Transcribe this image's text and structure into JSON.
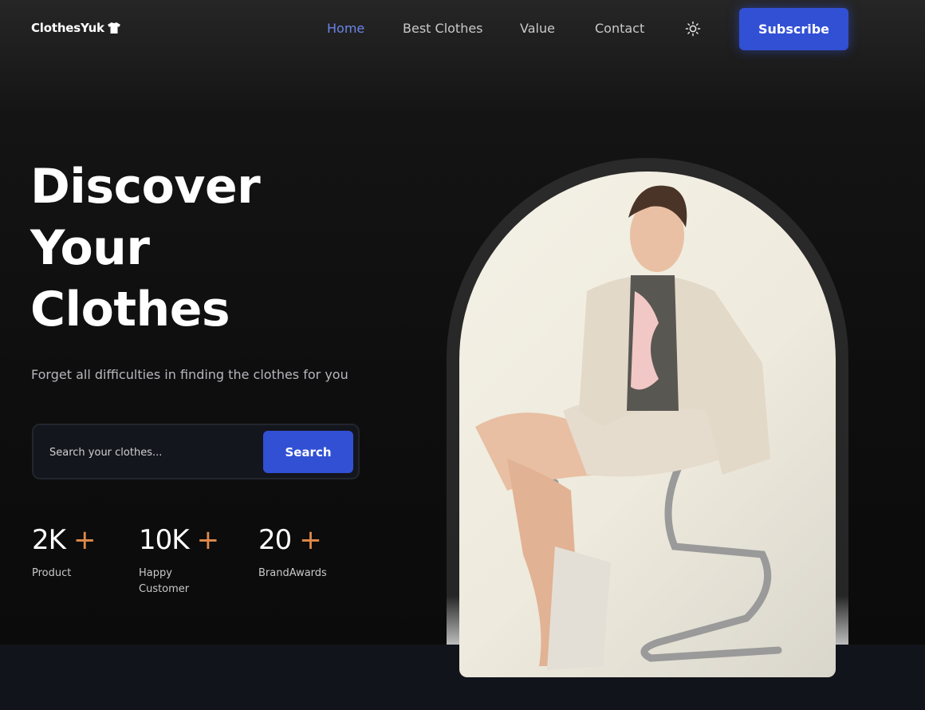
{
  "nav": {
    "logo": "ClothesYuk",
    "links": [
      "Home",
      "Best Clothes",
      "Value",
      "Contact"
    ],
    "active_link": "Home",
    "subscribe_label": "Subscribe"
  },
  "hero": {
    "headline": [
      "Discover",
      "Your",
      "Clothes"
    ],
    "subtitle": "Forget all difficulties in finding the clothes for you"
  },
  "search": {
    "placeholder": "Search your clothes...",
    "button_label": "Search"
  },
  "stats": [
    {
      "value": "2K",
      "plus": "+",
      "label": "Product"
    },
    {
      "value": "10K",
      "plus": "+",
      "label": "Happy Customer"
    },
    {
      "value": "20",
      "plus": "+",
      "label": "BrandAwards"
    }
  ],
  "icons": {
    "logo_icon": "tshirt-icon",
    "theme_toggle": "sun-icon"
  },
  "colors": {
    "accent": "#3150d4",
    "active_link": "#6b84e8",
    "stat_plus": "#e08a4a",
    "background": "#0e0e0e"
  }
}
